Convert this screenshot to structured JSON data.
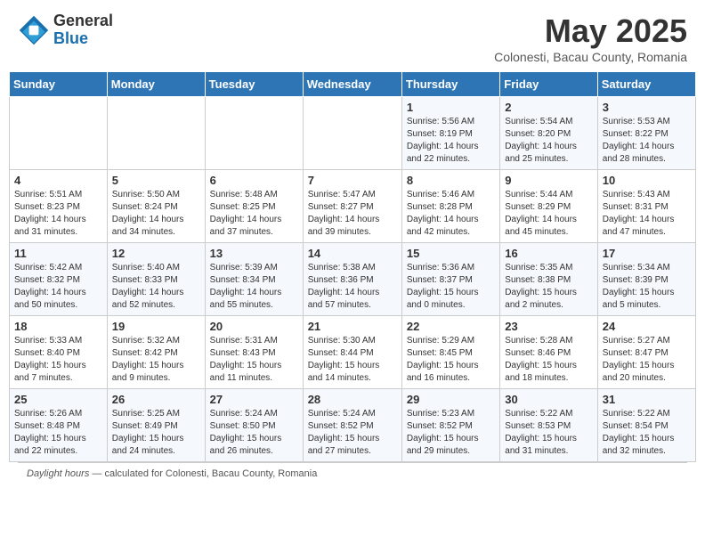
{
  "header": {
    "logo_general": "General",
    "logo_blue": "Blue",
    "month": "May 2025",
    "location": "Colonesti, Bacau County, Romania"
  },
  "days_of_week": [
    "Sunday",
    "Monday",
    "Tuesday",
    "Wednesday",
    "Thursday",
    "Friday",
    "Saturday"
  ],
  "weeks": [
    [
      {
        "day": "",
        "info": ""
      },
      {
        "day": "",
        "info": ""
      },
      {
        "day": "",
        "info": ""
      },
      {
        "day": "",
        "info": ""
      },
      {
        "day": "1",
        "info": "Sunrise: 5:56 AM\nSunset: 8:19 PM\nDaylight: 14 hours\nand 22 minutes."
      },
      {
        "day": "2",
        "info": "Sunrise: 5:54 AM\nSunset: 8:20 PM\nDaylight: 14 hours\nand 25 minutes."
      },
      {
        "day": "3",
        "info": "Sunrise: 5:53 AM\nSunset: 8:22 PM\nDaylight: 14 hours\nand 28 minutes."
      }
    ],
    [
      {
        "day": "4",
        "info": "Sunrise: 5:51 AM\nSunset: 8:23 PM\nDaylight: 14 hours\nand 31 minutes."
      },
      {
        "day": "5",
        "info": "Sunrise: 5:50 AM\nSunset: 8:24 PM\nDaylight: 14 hours\nand 34 minutes."
      },
      {
        "day": "6",
        "info": "Sunrise: 5:48 AM\nSunset: 8:25 PM\nDaylight: 14 hours\nand 37 minutes."
      },
      {
        "day": "7",
        "info": "Sunrise: 5:47 AM\nSunset: 8:27 PM\nDaylight: 14 hours\nand 39 minutes."
      },
      {
        "day": "8",
        "info": "Sunrise: 5:46 AM\nSunset: 8:28 PM\nDaylight: 14 hours\nand 42 minutes."
      },
      {
        "day": "9",
        "info": "Sunrise: 5:44 AM\nSunset: 8:29 PM\nDaylight: 14 hours\nand 45 minutes."
      },
      {
        "day": "10",
        "info": "Sunrise: 5:43 AM\nSunset: 8:31 PM\nDaylight: 14 hours\nand 47 minutes."
      }
    ],
    [
      {
        "day": "11",
        "info": "Sunrise: 5:42 AM\nSunset: 8:32 PM\nDaylight: 14 hours\nand 50 minutes."
      },
      {
        "day": "12",
        "info": "Sunrise: 5:40 AM\nSunset: 8:33 PM\nDaylight: 14 hours\nand 52 minutes."
      },
      {
        "day": "13",
        "info": "Sunrise: 5:39 AM\nSunset: 8:34 PM\nDaylight: 14 hours\nand 55 minutes."
      },
      {
        "day": "14",
        "info": "Sunrise: 5:38 AM\nSunset: 8:36 PM\nDaylight: 14 hours\nand 57 minutes."
      },
      {
        "day": "15",
        "info": "Sunrise: 5:36 AM\nSunset: 8:37 PM\nDaylight: 15 hours\nand 0 minutes."
      },
      {
        "day": "16",
        "info": "Sunrise: 5:35 AM\nSunset: 8:38 PM\nDaylight: 15 hours\nand 2 minutes."
      },
      {
        "day": "17",
        "info": "Sunrise: 5:34 AM\nSunset: 8:39 PM\nDaylight: 15 hours\nand 5 minutes."
      }
    ],
    [
      {
        "day": "18",
        "info": "Sunrise: 5:33 AM\nSunset: 8:40 PM\nDaylight: 15 hours\nand 7 minutes."
      },
      {
        "day": "19",
        "info": "Sunrise: 5:32 AM\nSunset: 8:42 PM\nDaylight: 15 hours\nand 9 minutes."
      },
      {
        "day": "20",
        "info": "Sunrise: 5:31 AM\nSunset: 8:43 PM\nDaylight: 15 hours\nand 11 minutes."
      },
      {
        "day": "21",
        "info": "Sunrise: 5:30 AM\nSunset: 8:44 PM\nDaylight: 15 hours\nand 14 minutes."
      },
      {
        "day": "22",
        "info": "Sunrise: 5:29 AM\nSunset: 8:45 PM\nDaylight: 15 hours\nand 16 minutes."
      },
      {
        "day": "23",
        "info": "Sunrise: 5:28 AM\nSunset: 8:46 PM\nDaylight: 15 hours\nand 18 minutes."
      },
      {
        "day": "24",
        "info": "Sunrise: 5:27 AM\nSunset: 8:47 PM\nDaylight: 15 hours\nand 20 minutes."
      }
    ],
    [
      {
        "day": "25",
        "info": "Sunrise: 5:26 AM\nSunset: 8:48 PM\nDaylight: 15 hours\nand 22 minutes."
      },
      {
        "day": "26",
        "info": "Sunrise: 5:25 AM\nSunset: 8:49 PM\nDaylight: 15 hours\nand 24 minutes."
      },
      {
        "day": "27",
        "info": "Sunrise: 5:24 AM\nSunset: 8:50 PM\nDaylight: 15 hours\nand 26 minutes."
      },
      {
        "day": "28",
        "info": "Sunrise: 5:24 AM\nSunset: 8:52 PM\nDaylight: 15 hours\nand 27 minutes."
      },
      {
        "day": "29",
        "info": "Sunrise: 5:23 AM\nSunset: 8:52 PM\nDaylight: 15 hours\nand 29 minutes."
      },
      {
        "day": "30",
        "info": "Sunrise: 5:22 AM\nSunset: 8:53 PM\nDaylight: 15 hours\nand 31 minutes."
      },
      {
        "day": "31",
        "info": "Sunrise: 5:22 AM\nSunset: 8:54 PM\nDaylight: 15 hours\nand 32 minutes."
      }
    ]
  ],
  "footer": {
    "daylight_label": "Daylight hours",
    "note": "calculated for Colonesti, Bacau County, Romania"
  }
}
